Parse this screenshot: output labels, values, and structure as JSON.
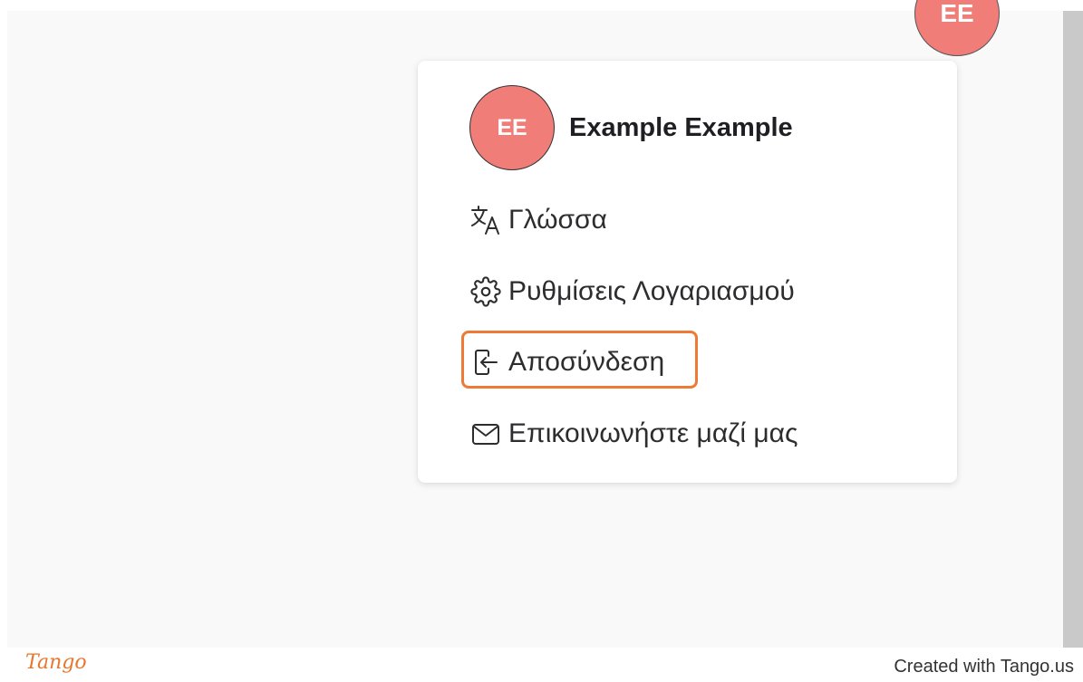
{
  "header": {
    "avatar_initials": "EE"
  },
  "menu": {
    "user": {
      "initials": "EE",
      "name": "Example Example"
    },
    "items": [
      {
        "icon": "translate-icon",
        "label": "Γλώσσα"
      },
      {
        "icon": "gear-icon",
        "label": "Ρυθμίσεις Λογαριασμού"
      },
      {
        "icon": "logout-icon",
        "label": "Αποσύνδεση",
        "highlighted": true
      },
      {
        "icon": "mail-icon",
        "label": "Επικοινωνήστε μαζί μας"
      }
    ]
  },
  "colors": {
    "avatar": "#f07d78",
    "highlight": "#ee7a35",
    "background": "#f9f9fa"
  },
  "footer": {
    "logo": "Tango",
    "credit": "Created with Tango.us"
  }
}
